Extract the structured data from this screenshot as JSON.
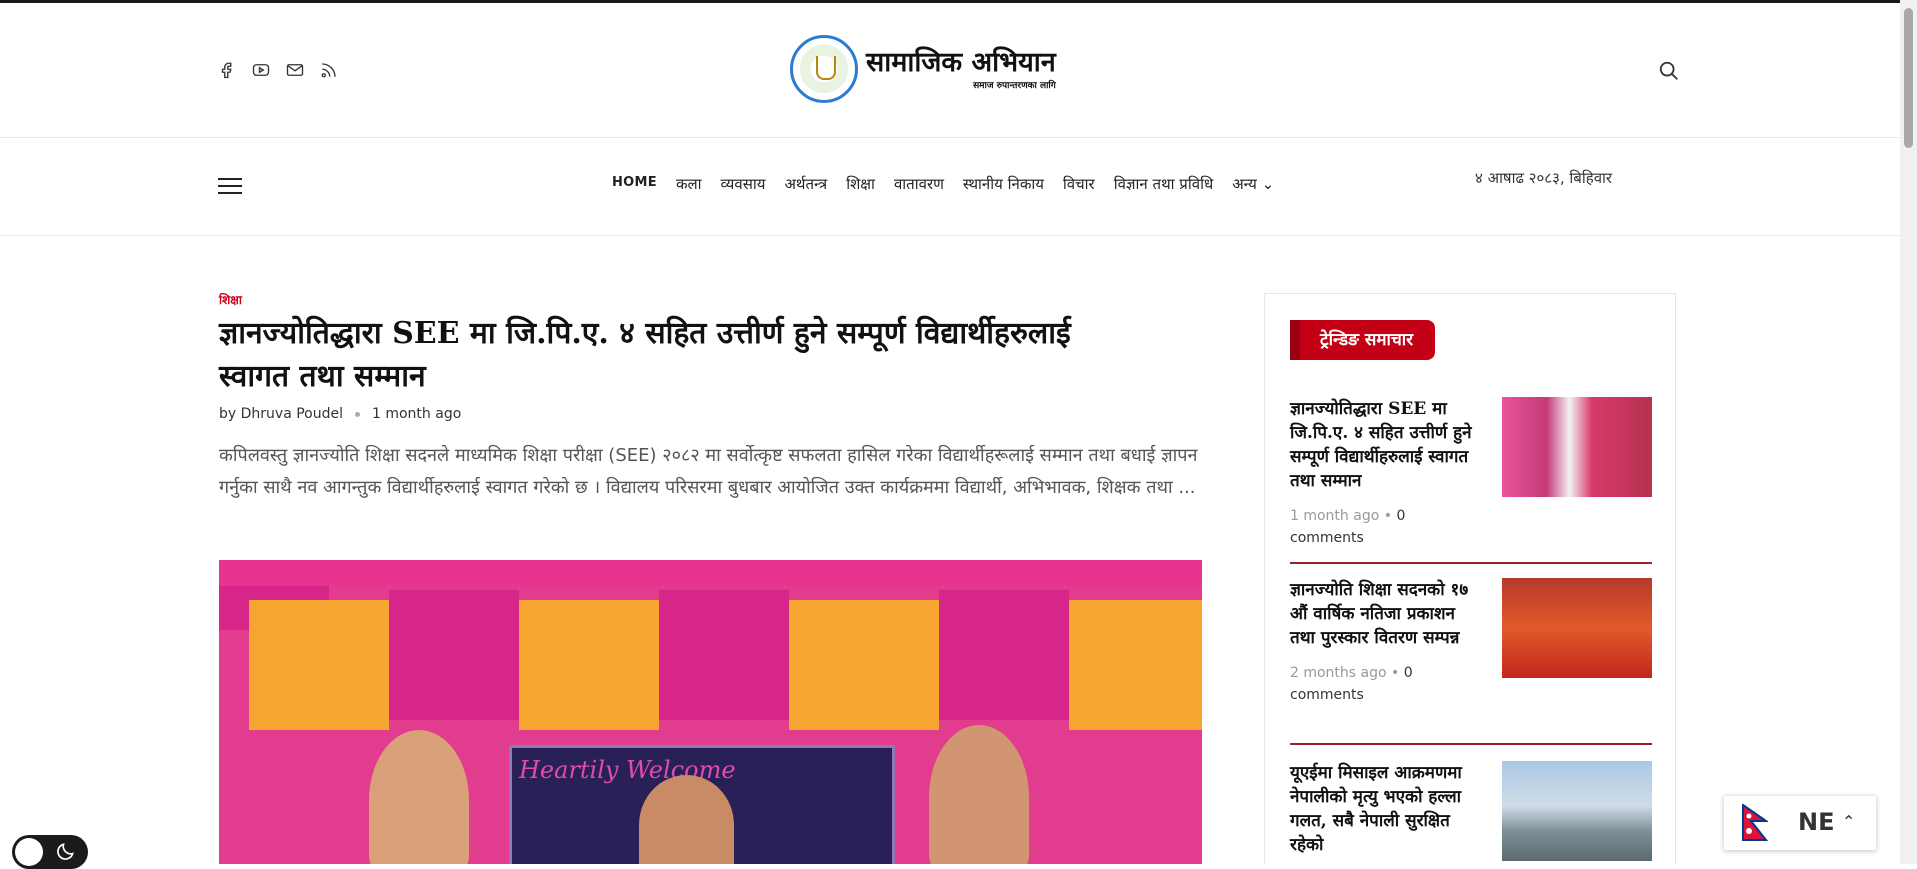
{
  "header": {
    "site_title": "सामाजिक अभियान",
    "site_tagline": "समाज रुपान्तरणका लागि",
    "social_icons": [
      "facebook-icon",
      "youtube-icon",
      "mail-icon",
      "rss-icon"
    ]
  },
  "nav": {
    "items": [
      "HOME",
      "कला",
      "व्यवसाय",
      "अर्थतन्त्र",
      "शिक्षा",
      "वातावरण",
      "स्थानीय निकाय",
      "विचार",
      "विज्ञान तथा प्रविधि",
      "अन्य"
    ],
    "date": "४ आषाढ २०८३, बिहिवार"
  },
  "article": {
    "category": "शिक्षा",
    "title": "ज्ञानज्योतिद्धारा SEE मा जि.पि.ए. ४ सहित उत्तीर्ण हुने सम्पूर्ण विद्यार्थीहरुलाई स्वागत तथा सम्मान",
    "author": "by Dhruva Poudel",
    "time": "1 month ago",
    "excerpt": "कपिलवस्तु ज्ञानज्योति शिक्षा सदनले माध्यमिक शिक्षा परीक्षा (SEE) २०८२ मा सर्वोत्कृष्ट सफलता हासिल गरेका विद्यार्थीहरूलाई सम्मान तथा बधाई ज्ञापन गर्नुका साथै नव आगन्तुक विद्यार्थीहरुलाई स्वागत गरेको छ । विद्यालय परिसरमा बुधबार आयोजित उक्त कार्यक्रममा विद्यार्थी, अभिभावक, शिक्षक तथा ...",
    "banner_text": "Heartily Welcome"
  },
  "sidebar": {
    "heading": "ट्रेन्डिङ समाचार",
    "items": [
      {
        "title": "ज्ञानज्योतिद्धारा SEE मा जि.पि.ए. ४ सहित उत्तीर्ण हुने सम्पूर्ण विद्यार्थीहरुलाई स्वागत तथा सम्मान",
        "time": "1 month ago",
        "comments": "0 comments"
      },
      {
        "title": "ज्ञानज्योति शिक्षा सदनको १७ औं वार्षिक नतिजा प्रकाशन तथा पुरस्कार वितरण सम्पन्न",
        "time": "2 months ago",
        "comments": "0 comments"
      },
      {
        "title": "यूएईमा मिसाइल आक्रमणमा नेपालीको मृत्यु भएको हल्ला गलत, सबै नेपाली सुरक्षित रहेको",
        "time": "",
        "comments": ""
      }
    ]
  },
  "language": {
    "code": "NE"
  },
  "colors": {
    "accent": "#c40016",
    "separator": "#9e1b32"
  }
}
